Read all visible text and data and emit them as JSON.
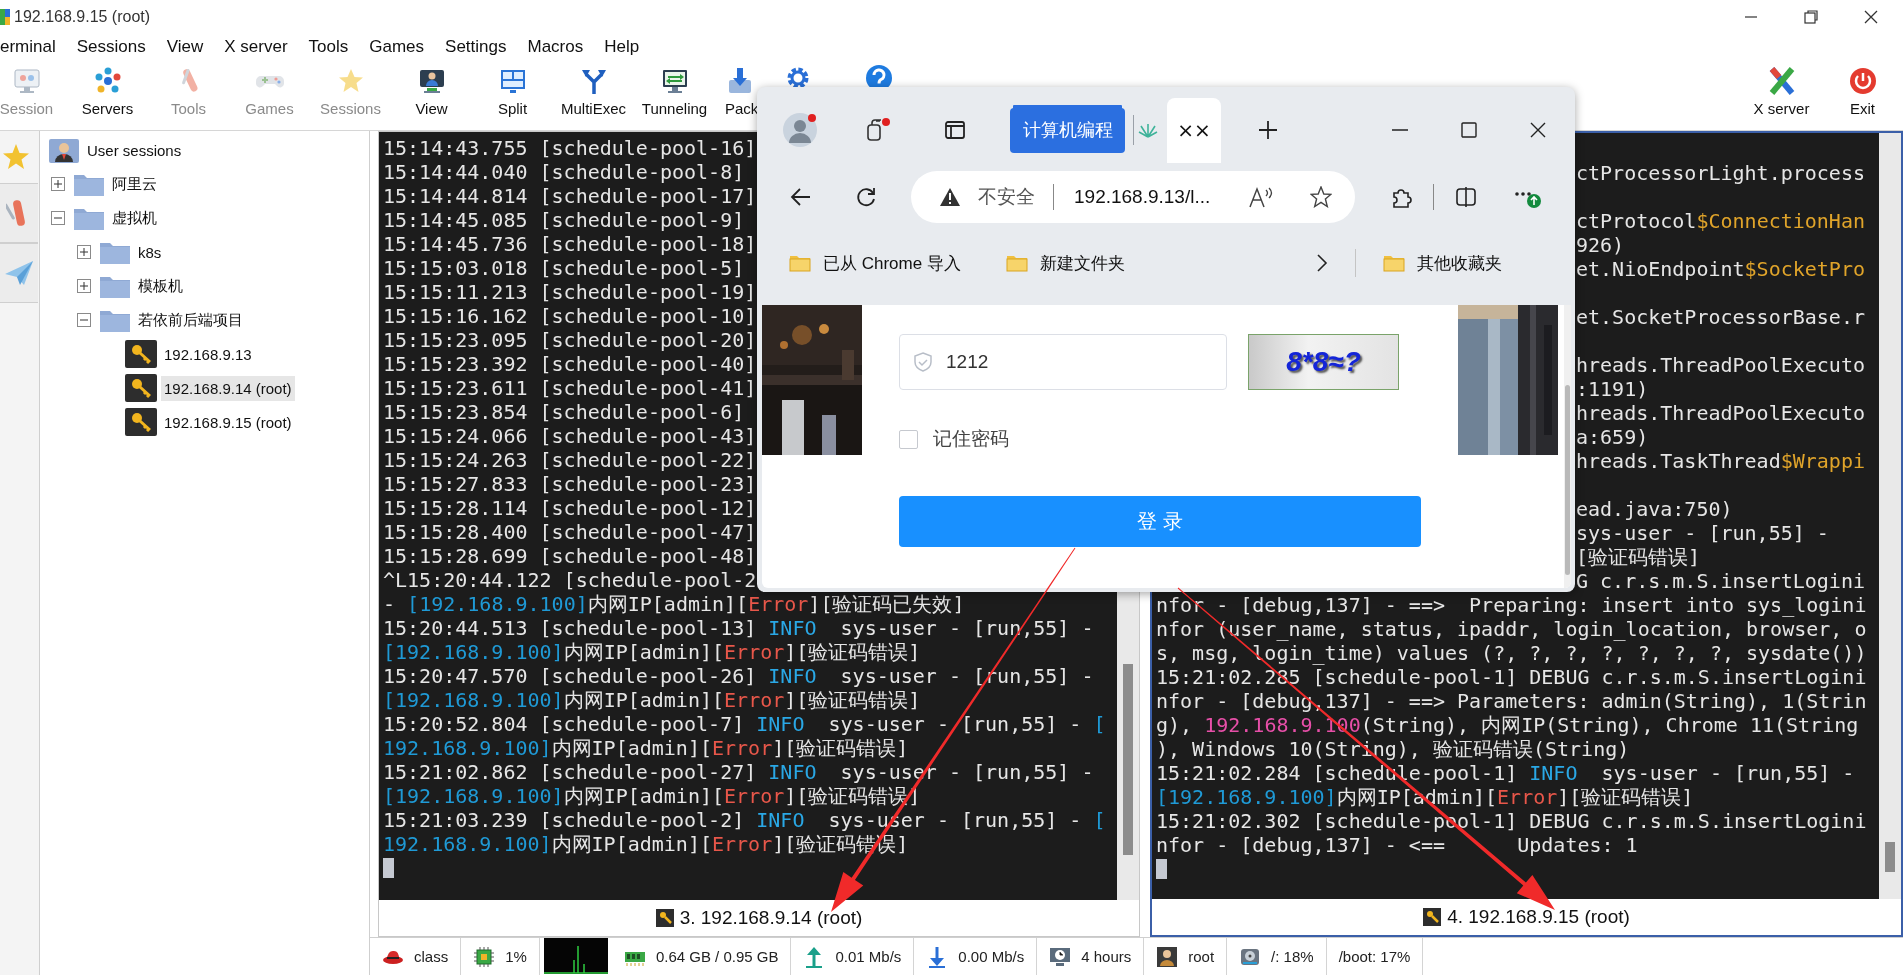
{
  "window": {
    "title": "192.168.9.15 (root)"
  },
  "menu": [
    "erminal",
    "Sessions",
    "View",
    "X server",
    "Tools",
    "Games",
    "Settings",
    "Macros",
    "Help"
  ],
  "toolbar": [
    {
      "label": "Session",
      "disabled": true,
      "clipped": false
    },
    {
      "label": "Servers",
      "disabled": false,
      "clipped": false
    },
    {
      "label": "Tools",
      "disabled": true,
      "clipped": false
    },
    {
      "label": "Games",
      "disabled": true,
      "clipped": false
    },
    {
      "label": "Sessions",
      "disabled": true,
      "clipped": false
    },
    {
      "label": "View",
      "disabled": false,
      "clipped": false
    },
    {
      "label": "Split",
      "disabled": false,
      "clipped": false
    },
    {
      "label": "MultiExec",
      "disabled": false,
      "clipped": false
    },
    {
      "label": "Tunneling",
      "disabled": false,
      "clipped": false
    },
    {
      "label": "Pack",
      "disabled": false,
      "clipped": true
    },
    {
      "disabled": false,
      "clipped": true
    },
    {
      "disabled": false,
      "clipped": true
    }
  ],
  "toolbar_right": [
    {
      "label": "X server",
      "disabled": false
    },
    {
      "label": "Exit",
      "disabled": false
    }
  ],
  "sidebar": {
    "tree": [
      {
        "kind": "root",
        "label": "User sessions",
        "children": [
          {
            "kind": "folder",
            "label": "阿里云",
            "expanded": false
          },
          {
            "kind": "folder",
            "label": "虚拟机",
            "expanded": true,
            "children": [
              {
                "kind": "folder",
                "label": "k8s",
                "expanded": false
              },
              {
                "kind": "folder",
                "label": "模板机",
                "expanded": false
              },
              {
                "kind": "folder",
                "label": "若依前后端项目",
                "expanded": true,
                "children": [
                  {
                    "kind": "session",
                    "label": "192.168.9.13",
                    "selected": false
                  },
                  {
                    "kind": "session",
                    "label": "192.168.9.14 (root)",
                    "selected": true
                  },
                  {
                    "kind": "session",
                    "label": "192.168.9.15 (root)",
                    "selected": false
                  }
                ]
              }
            ]
          }
        ]
      }
    ]
  },
  "panes": [
    {
      "label": "3. 192.168.9.14 (root)",
      "active": false,
      "lines": [
        {
          "kind": "text",
          "text": "15:14:43.755 [schedule-pool-16]"
        },
        {
          "kind": "text",
          "text": "15:14:44.040 [schedule-pool-8]"
        },
        {
          "kind": "text",
          "text": "15:14:44.814 [schedule-pool-17]"
        },
        {
          "kind": "text",
          "text": "15:14:45.085 [schedule-pool-9]"
        },
        {
          "kind": "text",
          "text": "15:14:45.736 [schedule-pool-18]"
        },
        {
          "kind": "text",
          "text": "15:15:03.018 [schedule-pool-5]"
        },
        {
          "kind": "text",
          "text": "15:15:11.213 [schedule-pool-19]"
        },
        {
          "kind": "text",
          "text": "15:15:16.162 [schedule-pool-10]"
        },
        {
          "kind": "text",
          "text": "15:15:23.095 [schedule-pool-20]"
        },
        {
          "kind": "text",
          "text": "15:15:23.392 [schedule-pool-40]"
        },
        {
          "kind": "text",
          "text": "15:15:23.611 [schedule-pool-41]"
        },
        {
          "kind": "text",
          "text": "15:15:23.854 [schedule-pool-6]"
        },
        {
          "kind": "text",
          "text": "15:15:24.066 [schedule-pool-43]"
        },
        {
          "kind": "text",
          "text": "15:15:24.263 [schedule-pool-22]"
        },
        {
          "kind": "text",
          "text": "15:15:27.833 [schedule-pool-23]"
        },
        {
          "kind": "text",
          "text": "15:15:28.114 [schedule-pool-12]"
        },
        {
          "kind": "text",
          "text": "15:15:28.400 [schedule-pool-47]"
        },
        {
          "kind": "text",
          "text": "15:15:28.699 [schedule-pool-48]"
        },
        {
          "kind": "text",
          "text": "^L15:20:44.122 [schedule-pool-2"
        },
        {
          "kind": "text",
          "spans": [
            {
              "color": "#e6e6e6",
              "text": "- "
            },
            {
              "color": "#1f9ad6",
              "text": "[192.168.9.100]"
            },
            {
              "color": "#e6e6e6",
              "text": "内网IP[admin]["
            },
            {
              "color": "#e8574a",
              "text": "Error"
            },
            {
              "color": "#e6e6e6",
              "text": "][验证码已失效]"
            }
          ]
        },
        {
          "kind": "text",
          "spans": [
            {
              "color": "#e6e6e6",
              "text": "15:20:44.513 [schedule-pool-13] "
            },
            {
              "color": "#2aa8e6",
              "text": "INFO"
            },
            {
              "color": "#e6e6e6",
              "text": "  sys-user - [run,55] -"
            }
          ]
        },
        {
          "kind": "text",
          "spans": [
            {
              "color": "#1f9ad6",
              "text": "[192.168.9.100]"
            },
            {
              "color": "#e6e6e6",
              "text": "内网IP[admin]["
            },
            {
              "color": "#e8574a",
              "text": "Error"
            },
            {
              "color": "#e6e6e6",
              "text": "][验证码错误]"
            }
          ]
        },
        {
          "kind": "text",
          "spans": [
            {
              "color": "#e6e6e6",
              "text": "15:20:47.570 [schedule-pool-26] "
            },
            {
              "color": "#2aa8e6",
              "text": "INFO"
            },
            {
              "color": "#e6e6e6",
              "text": "  sys-user - [run,55] -"
            }
          ]
        },
        {
          "kind": "text",
          "spans": [
            {
              "color": "#1f9ad6",
              "text": "[192.168.9.100]"
            },
            {
              "color": "#e6e6e6",
              "text": "内网IP[admin]["
            },
            {
              "color": "#e8574a",
              "text": "Error"
            },
            {
              "color": "#e6e6e6",
              "text": "][验证码错误]"
            }
          ]
        },
        {
          "kind": "text",
          "spans": [
            {
              "color": "#e6e6e6",
              "text": "15:20:52.804 [schedule-pool-7] "
            },
            {
              "color": "#2aa8e6",
              "text": "INFO"
            },
            {
              "color": "#e6e6e6",
              "text": "  sys-user - [run,55] - "
            },
            {
              "color": "#1f9ad6",
              "text": "["
            }
          ]
        },
        {
          "kind": "text",
          "spans": [
            {
              "color": "#1f9ad6",
              "text": "192.168.9.100]"
            },
            {
              "color": "#e6e6e6",
              "text": "内网IP[admin]["
            },
            {
              "color": "#e8574a",
              "text": "Error"
            },
            {
              "color": "#e6e6e6",
              "text": "][验证码错误]"
            }
          ]
        },
        {
          "kind": "text",
          "spans": [
            {
              "color": "#e6e6e6",
              "text": "15:21:02.862 [schedule-pool-27] "
            },
            {
              "color": "#2aa8e6",
              "text": "INFO"
            },
            {
              "color": "#e6e6e6",
              "text": "  sys-user - [run,55] -"
            }
          ]
        },
        {
          "kind": "text",
          "spans": [
            {
              "color": "#1f9ad6",
              "text": "[192.168.9.100]"
            },
            {
              "color": "#e6e6e6",
              "text": "内网IP[admin]["
            },
            {
              "color": "#e8574a",
              "text": "Error"
            },
            {
              "color": "#e6e6e6",
              "text": "][验证码错误]"
            }
          ]
        },
        {
          "kind": "text",
          "spans": [
            {
              "color": "#e6e6e6",
              "text": "15:21:03.239 [schedule-pool-2] "
            },
            {
              "color": "#2aa8e6",
              "text": "INFO"
            },
            {
              "color": "#e6e6e6",
              "text": "  sys-user - [run,55] - "
            },
            {
              "color": "#1f9ad6",
              "text": "["
            }
          ]
        },
        {
          "kind": "text",
          "spans": [
            {
              "color": "#1f9ad6",
              "text": "192.168.9.100]"
            },
            {
              "color": "#e6e6e6",
              "text": "内网IP[admin]["
            },
            {
              "color": "#e8574a",
              "text": "Error"
            },
            {
              "color": "#e6e6e6",
              "text": "][验证码错误]"
            }
          ]
        },
        {
          "kind": "cursor"
        }
      ]
    },
    {
      "label": "4. 192.168.9.15 (root)",
      "active": true,
      "lines": [
        {
          "kind": "blank"
        },
        {
          "kind": "text",
          "covered": true,
          "text": "ctProcessorLight.process"
        },
        {
          "kind": "blank"
        },
        {
          "kind": "text",
          "covered": true,
          "spans": [
            {
              "color": "#e6e6e6",
              "text": "ctProtocol"
            },
            {
              "color": "#e0a42a",
              "text": "$ConnectionHan"
            }
          ]
        },
        {
          "kind": "text",
          "covered": true,
          "text": "926)"
        },
        {
          "kind": "text",
          "covered": true,
          "spans": [
            {
              "color": "#e6e6e6",
              "text": "et.NioEndpoint"
            },
            {
              "color": "#e0a42a",
              "text": "$SocketPro"
            }
          ]
        },
        {
          "kind": "blank"
        },
        {
          "kind": "text",
          "covered": true,
          "text": "et.SocketProcessorBase.r"
        },
        {
          "kind": "blank"
        },
        {
          "kind": "text",
          "covered": true,
          "text": "hreads.ThreadPoolExecuto"
        },
        {
          "kind": "text",
          "covered": true,
          "text": ":1191)"
        },
        {
          "kind": "text",
          "covered": true,
          "text": "hreads.ThreadPoolExecuto"
        },
        {
          "kind": "text",
          "covered": true,
          "text": "a:659)"
        },
        {
          "kind": "text",
          "covered": true,
          "spans": [
            {
              "color": "#e6e6e6",
              "text": "hreads.TaskThread"
            },
            {
              "color": "#e0a42a",
              "text": "$Wrappi"
            }
          ]
        },
        {
          "kind": "blank"
        },
        {
          "kind": "text",
          "covered": true,
          "text": "ead.java:750)"
        },
        {
          "kind": "text",
          "covered": true,
          "text": "sys-user - [run,55] -"
        },
        {
          "kind": "text",
          "covered": true,
          "text": "[验证码错误]"
        },
        {
          "kind": "text",
          "covered": true,
          "text": "G c.r.s.m.S.insertLogini"
        },
        {
          "kind": "text",
          "covered": false,
          "text": "nfor - [debug,137] - ==>  Preparing: insert into sys_logini"
        },
        {
          "kind": "text",
          "covered": false,
          "text": "nfor (user_name, status, ipaddr, login_location, browser, o"
        },
        {
          "kind": "text",
          "covered": false,
          "text": "s, msg, login_time) values (?, ?, ?, ?, ?, ?, ?, sysdate())"
        },
        {
          "kind": "text",
          "covered": false,
          "text": "15:21:02.285 [schedule-pool-1] DEBUG c.r.s.m.S.insertLogini"
        },
        {
          "kind": "text",
          "covered": false,
          "text": "nfor - [debug,137] - ==> Parameters: admin(String), 1(Strin"
        },
        {
          "kind": "text",
          "covered": false,
          "spans": [
            {
              "color": "#e6e6e6",
              "text": "g), "
            },
            {
              "color": "#e74fa8",
              "text": "192.168.9.100"
            },
            {
              "color": "#e6e6e6",
              "text": "(String), 内网IP(String), Chrome 11(String"
            }
          ]
        },
        {
          "kind": "text",
          "covered": false,
          "text": "), Windows 10(String), 验证码错误(String)"
        },
        {
          "kind": "text",
          "covered": false,
          "spans": [
            {
              "color": "#e6e6e6",
              "text": "15:21:02.284 [schedule-pool-1] "
            },
            {
              "color": "#2aa8e6",
              "text": "INFO"
            },
            {
              "color": "#e6e6e6",
              "text": "  sys-user - [run,55] -"
            }
          ]
        },
        {
          "kind": "text",
          "covered": false,
          "spans": [
            {
              "color": "#1f9ad6",
              "text": "[192.168.9.100]"
            },
            {
              "color": "#e6e6e6",
              "text": "内网IP[admin]["
            },
            {
              "color": "#e8574a",
              "text": "Error"
            },
            {
              "color": "#e6e6e6",
              "text": "][验证码错误]"
            }
          ]
        },
        {
          "kind": "text",
          "covered": false,
          "text": "15:21:02.302 [schedule-pool-1] DEBUG c.r.s.m.S.insertLogini"
        },
        {
          "kind": "text",
          "covered": false,
          "text": "nfor - [debug,137] - <==      Updates: 1"
        },
        {
          "kind": "cursor"
        }
      ]
    }
  ],
  "status_bar": [
    {
      "kind": "item",
      "text": "class"
    },
    {
      "kind": "item",
      "text": "1%"
    },
    {
      "kind": "graph"
    },
    {
      "kind": "item",
      "text": "0.64 GB / 0.95 GB"
    },
    {
      "kind": "item",
      "text": "0.01 Mb/s"
    },
    {
      "kind": "item",
      "text": "0.00 Mb/s"
    },
    {
      "kind": "item",
      "text": "4 hours"
    },
    {
      "kind": "item",
      "text": "root"
    },
    {
      "kind": "item",
      "text": "/: 18%"
    },
    {
      "kind": "item",
      "text": "/boot: 17%"
    }
  ],
  "browser": {
    "tab_group": "计算机编程",
    "active_tab": "××",
    "address": {
      "security": "不安全",
      "url": "192.168.9.13/l..."
    },
    "favorites": [
      "已从 Chrome 导入",
      "新建文件夹"
    ],
    "other_favorites": "其他收藏夹",
    "page": {
      "captcha_field": {
        "value": "1212"
      },
      "captcha_image": "8*8≈?",
      "remember": {
        "label": "记住密码",
        "checked": false
      },
      "login_button": "登 录"
    }
  }
}
